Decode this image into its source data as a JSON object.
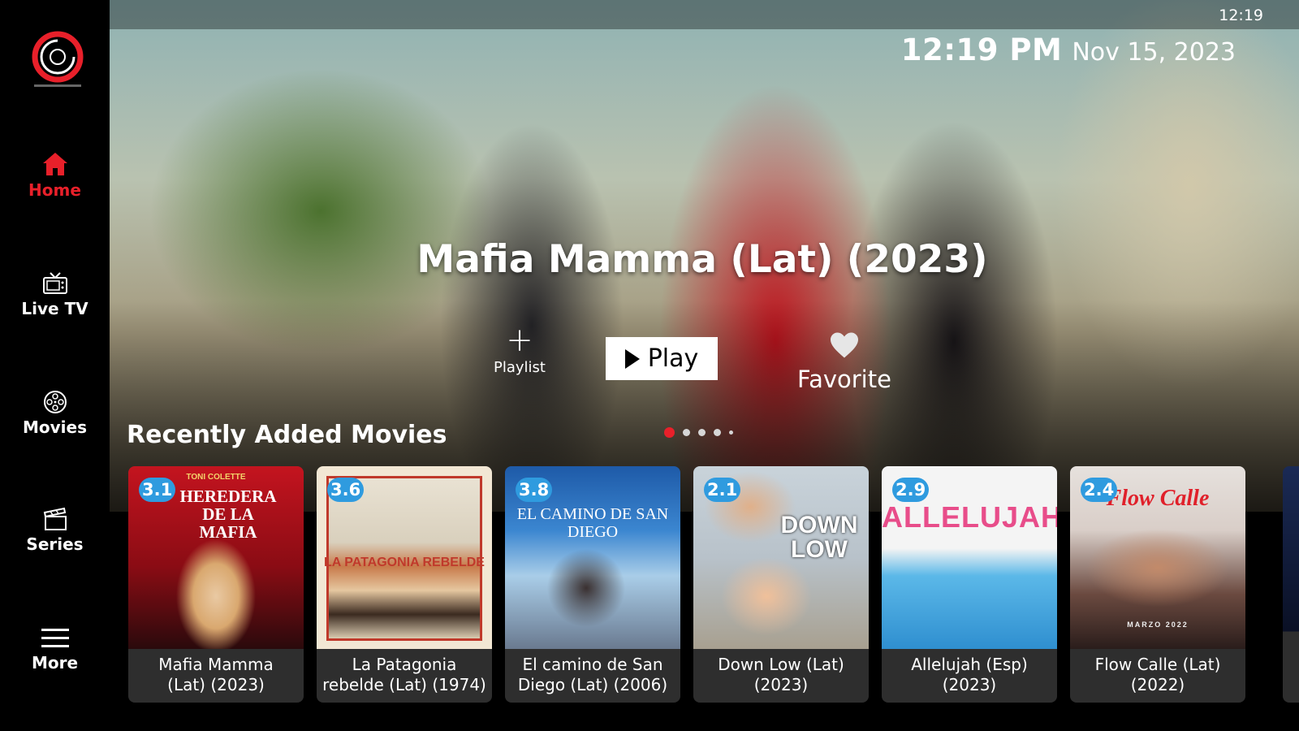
{
  "status_bar": {
    "time": "12:19"
  },
  "clock": {
    "time": "12:19 PM",
    "date": "Nov 15, 2023"
  },
  "sidebar": {
    "items": [
      {
        "label": "Home",
        "icon": "home-icon",
        "active": true
      },
      {
        "label": "Live TV",
        "icon": "tv-icon",
        "active": false
      },
      {
        "label": "Movies",
        "icon": "film-reel-icon",
        "active": false
      },
      {
        "label": "Series",
        "icon": "clapperboard-icon",
        "active": false
      },
      {
        "label": "More",
        "icon": "hamburger-menu-icon",
        "active": false
      }
    ]
  },
  "hero": {
    "title": "Mafia Mamma (Lat) (2023)",
    "playlist_label": "Playlist",
    "play_label": "Play",
    "favorite_label": "Favorite",
    "carousel": {
      "count": 5,
      "active_index": 0
    }
  },
  "section": {
    "title": "Recently Added Movies"
  },
  "movies": [
    {
      "rating": "3.1",
      "title_line1": "Mafia Mamma",
      "title_line2": "(Lat) (2023)",
      "poster_text_top": "TONI COLETTE",
      "poster_text_main": "HEREDERA DE LA MAFIA"
    },
    {
      "rating": "3.6",
      "title_line1": "La Patagonia",
      "title_line2": "rebelde (Lat) (1974)",
      "poster_text_main": "LA PATAGONIA REBELDE"
    },
    {
      "rating": "3.8",
      "title_line1": "El camino de San",
      "title_line2": "Diego (Lat) (2006)",
      "poster_text_main": "EL CAMINO DE SAN DIEGO"
    },
    {
      "rating": "2.1",
      "title_line1": "Down Low (Lat)",
      "title_line2": "(2023)",
      "poster_text_main": "DOWN LOW"
    },
    {
      "rating": "2.9",
      "title_line1": "Allelujah (Esp)",
      "title_line2": "(2023)",
      "poster_text_main": "ALLELUJAH"
    },
    {
      "rating": "2.4",
      "title_line1": "Flow Calle (Lat)",
      "title_line2": "(2022)",
      "poster_text_main": "Flow Calle",
      "poster_text_sub": "MARZO 2022"
    }
  ],
  "colors": {
    "accent": "#e8202a",
    "rating_badge": "#2f9bdf",
    "card_bg": "#2e2e2e"
  }
}
